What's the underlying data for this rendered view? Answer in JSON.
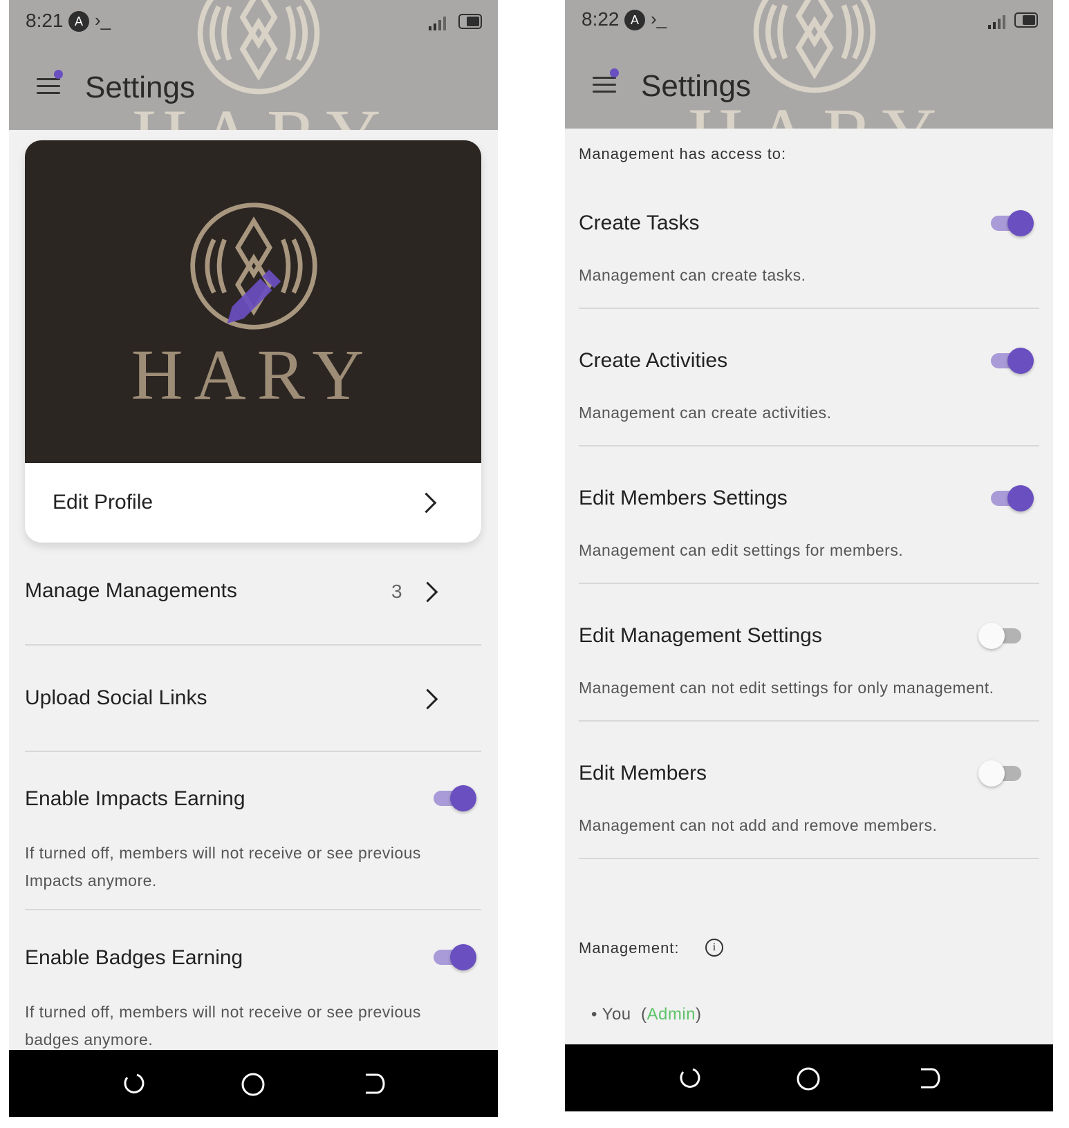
{
  "colors": {
    "accent": "#6a4fc0",
    "header_bg": "#a9a8a7",
    "admin_green": "#5dc46a"
  },
  "left": {
    "status": {
      "time": "8:21",
      "badge": "A",
      "prompt": "›_"
    },
    "header": {
      "title": "Settings",
      "brand_word": "HARY"
    },
    "profile_card": {
      "brand_word": "HARY",
      "edit_label": "Edit Profile"
    },
    "rows": [
      {
        "title": "Manage Managements",
        "count": "3"
      },
      {
        "title": "Upload Social Links"
      }
    ],
    "toggles": [
      {
        "title": "Enable Impacts Earning",
        "enabled": true,
        "desc_line1": "If turned off, members will not receive or see previous",
        "desc_line2": "Impacts anymore."
      },
      {
        "title": "Enable Badges Earning",
        "enabled": true,
        "desc_line1": "If turned off, members will not receive or see previous",
        "desc_line2": "badges anymore."
      }
    ]
  },
  "right": {
    "status": {
      "time": "8:22",
      "badge": "A",
      "prompt": "›_"
    },
    "header": {
      "title": "Settings",
      "brand_word": "HARY"
    },
    "access_label": "Management has access to:",
    "permissions": [
      {
        "title": "Create Tasks",
        "enabled": true,
        "desc": "Management can create tasks."
      },
      {
        "title": "Create Activities",
        "enabled": true,
        "desc": "Management can create activities."
      },
      {
        "title": "Edit Members Settings",
        "enabled": true,
        "desc": "Management can edit settings for members."
      },
      {
        "title": "Edit Management Settings",
        "enabled": false,
        "desc": "Management can not edit settings for only management."
      },
      {
        "title": "Edit Members",
        "enabled": false,
        "desc": "Management can not add and remove members."
      }
    ],
    "management_label": "Management:",
    "member": {
      "bullet": "•",
      "name": "You",
      "role": "Admin"
    }
  },
  "icons": {
    "menu": "menu-icon",
    "info": "info-icon",
    "chevron": "chevron-right-icon",
    "nav_back": "nav-back-icon",
    "nav_home": "nav-home-icon",
    "nav_recent": "nav-recent-icon"
  }
}
